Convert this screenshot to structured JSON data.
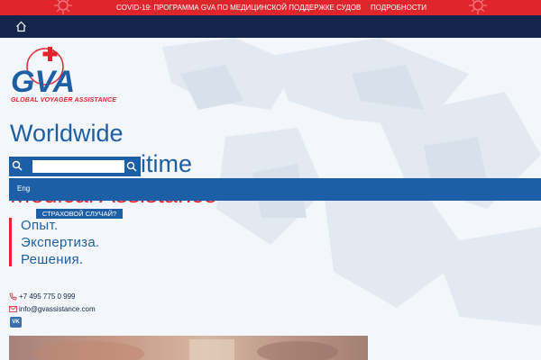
{
  "covid_bar": {
    "text": "COVID-19: ПРОГРАММА GVA ПО МЕДИЦИНСКОЙ ПОДДЕРЖКЕ СУДОВ",
    "more_label": "ПОДРОБНОСТИ",
    "bg_color": "#e0262c"
  },
  "nav": {
    "home_icon": "home-icon",
    "bg_color": "#13254a"
  },
  "logo": {
    "text": "GVA",
    "caption": "GLOBAL VOYAGER ASSISTANCE"
  },
  "hero": {
    "line1": "Worldwide",
    "line2": "aritime",
    "line3": "Medical Assistance"
  },
  "search": {
    "placeholder": "",
    "value": ""
  },
  "language": {
    "label": "Eng"
  },
  "claim_button": {
    "label": "СТРАХОВОЙ СЛУЧАЙ?"
  },
  "tagline": [
    "Опыт.",
    "Экспертиза.",
    "Решения."
  ],
  "contacts": {
    "phone": "+7 495 775 0 999",
    "email": "info@gvassistance.com",
    "social": "VK"
  },
  "colors": {
    "brand_blue": "#1d5fa6",
    "brand_red": "#e0262c",
    "navy": "#13254a"
  }
}
